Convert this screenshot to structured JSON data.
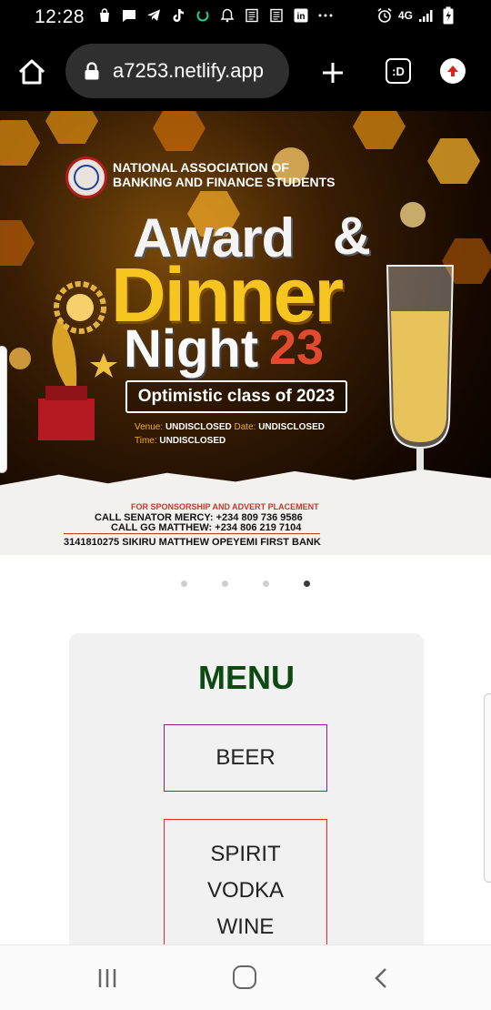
{
  "status_bar": {
    "time": "12:28",
    "network": "4G"
  },
  "browser": {
    "url": "a7253.netlify.app",
    "tab_icon_label": ":D"
  },
  "banner": {
    "org_name_line1": "NATIONAL ASSOCIATION OF",
    "org_name_line2": "BANKING AND FINANCE STUDENTS",
    "title_award": "Award",
    "title_amp": "&",
    "title_dinner": "Dinner",
    "title_night": "Night",
    "title_year": "23",
    "class_label": "Optimistic class of 2023",
    "venue_label": "Venue:",
    "venue_value": "UNDISCLOSED",
    "date_label": "Date:",
    "date_value": "UNDISCLOSED",
    "time_label": "Time:",
    "time_value": "UNDISCLOSED",
    "sponsorship": "FOR SPONSORSHIP AND ADVERT PLACEMENT",
    "call1": "CALL SENATOR MERCY: +234 809 736 9586",
    "call2": "CALL GG MATTHEW: +234 806 219 7104",
    "bank": "3141810275 SIKIRU MATTHEW OPEYEMI FIRST BANK"
  },
  "carousel": {
    "total_slides": 4,
    "active_slide": 4
  },
  "menu": {
    "title": "MENU",
    "item_beer": "BEER",
    "item_spirit": "SPIRIT",
    "item_vodka": "VODKA",
    "item_wine": "WINE"
  },
  "colors": {
    "menu_title": "#0d4a12",
    "beer_border": "#8b1e8b",
    "spirits_border": "#e02a2a",
    "dinner_gold": "#f6c51f",
    "year_red": "#e14a2c"
  },
  "icons": {
    "home": "home-icon",
    "lock": "lock-icon",
    "new_tab": "plus-icon",
    "update": "update-arrow-icon",
    "nav_recent": "recent-apps-icon",
    "nav_home": "home-circle-icon",
    "nav_back": "back-chevron-icon"
  }
}
